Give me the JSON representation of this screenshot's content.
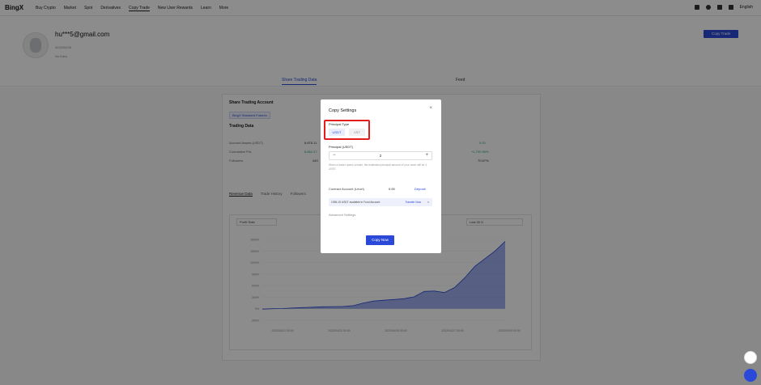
{
  "nav": {
    "logo": "BingX",
    "items": [
      "Buy Crypto",
      "Market",
      "Spot",
      "Derivatives",
      "Copy Trade",
      "New User Rewards",
      "Learn",
      "More"
    ],
    "language": "English"
  },
  "profile": {
    "email": "hu***5@gmail.com",
    "date": "2022/04/05",
    "no_data": "No Data",
    "copy_trade_btn": "Copy Trade"
  },
  "tabs": [
    "Share Trading Data",
    "Feed"
  ],
  "account": {
    "title": "Share Trading Account",
    "chip": "BingX Standard Futures",
    "trading_data": "Trading Data",
    "rows": [
      {
        "label": "Account Assets (USDT)",
        "val": "8,878.11"
      },
      {
        "label": "Cumulative PnL",
        "val": "8,882.47"
      },
      {
        "label": "Followers",
        "val": "449"
      }
    ],
    "right_vals": [
      "0.00",
      "+1,790.96%",
      "70.67%"
    ],
    "subtabs": [
      "Revenue Data",
      "Trade History",
      "Followers"
    ],
    "chart_dropdown_left": "Profit Rate",
    "chart_dropdown_right": "Last 30 D"
  },
  "chart_data": {
    "type": "area",
    "x_ticks": [
      "2022/04/21 00:00",
      "2022/04/23 00:00",
      "2022/04/25 00:00",
      "2022/04/27 00:00",
      "2022/04/29 00:00"
    ],
    "y_ticks": [
      "1800%",
      "1500%",
      "1200%",
      "900%",
      "600%",
      "300%",
      "0%",
      "-300%"
    ],
    "series": [
      {
        "values": [
          -10,
          0,
          5,
          20,
          30,
          40,
          50,
          55,
          60,
          80,
          150,
          200,
          220,
          240,
          260,
          310,
          450,
          460,
          420,
          550,
          800,
          1100,
          1300,
          1500,
          1750
        ]
      }
    ]
  },
  "modal": {
    "title": "Copy Settings",
    "close": "×",
    "principal_type_label": "Principal Type",
    "opt_usdt": "USDT",
    "opt_vst": "VST",
    "principal_label": "Principal (USDT)",
    "minus": "−",
    "plus": "+",
    "value": "2",
    "note": "When a trader opens a trade, the estimated principal amount of your order will be 2 USDT",
    "contract_label": "Contract Account (Level)",
    "contract_val": "0.00",
    "deposit": "Deposit",
    "available": "1096.15 USDT available in Fund Account",
    "transfer": "Transfer Now",
    "x": "×",
    "advanced": "Advanced Settings",
    "copy_now": "Copy Now"
  },
  "colors": {
    "accent": "#2a49d8",
    "highlight": "#e41c1c"
  }
}
